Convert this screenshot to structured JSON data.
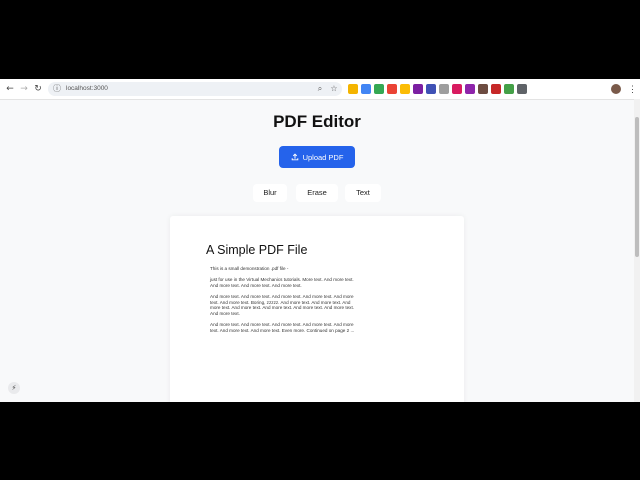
{
  "browser": {
    "url": "localhost:3000",
    "nav": {
      "back": "←",
      "forward": "→",
      "reload": "↻"
    },
    "extension_colors": [
      "#f4b400",
      "#4285f4",
      "#34a853",
      "#ea4335",
      "#fbbc05",
      "#7b1fa2",
      "#3f51b5",
      "#9e9e9e",
      "#d81b60",
      "#8e24aa",
      "#6d4c41",
      "#c62828",
      "#43a047",
      "#5f6368"
    ]
  },
  "app": {
    "title": "PDF Editor",
    "upload_label": "Upload PDF",
    "tools": [
      "Blur",
      "Erase",
      "Text"
    ]
  },
  "pdf": {
    "title": "A Simple PDF File",
    "paragraphs": [
      "This is a small demonstration .pdf file -",
      "just for use in the Virtual Mechanics tutorials. More text. And more text. And more text. And more text. And more text.",
      "And more text. And more text. And more text. And more text. And more text. And more text. Boring, zzzzz. And more text. And more text. And more text. And more text. And more text. And more text. And more text. And more text.",
      "And more text. And more text. And more text. And more text. And more text. And more text. And more text. Even more. Continued on page 2 ..."
    ]
  }
}
